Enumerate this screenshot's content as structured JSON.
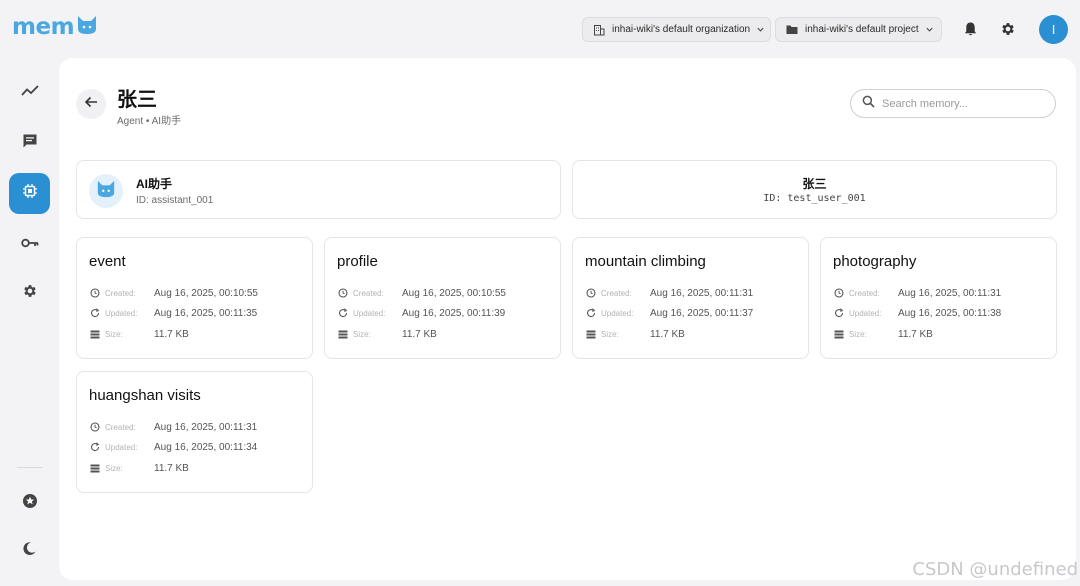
{
  "app": {
    "logo_text": "mem"
  },
  "header": {
    "organization": "inhai-wiki's default organization",
    "project": "inhai-wiki's default project",
    "avatar_initial": "I"
  },
  "sidebar": {
    "items": [
      {
        "name": "activity",
        "icon": "trend-chart-icon",
        "active": false
      },
      {
        "name": "chat",
        "icon": "message-icon",
        "active": false
      },
      {
        "name": "agents",
        "icon": "chip-icon",
        "active": true
      },
      {
        "name": "api-keys",
        "icon": "key-icon",
        "active": false
      },
      {
        "name": "settings",
        "icon": "gear-icon",
        "active": false
      }
    ],
    "bottom": [
      {
        "name": "favorites",
        "icon": "star-icon"
      },
      {
        "name": "theme",
        "icon": "moon-icon"
      }
    ]
  },
  "page": {
    "title": "张三",
    "subtitle": "Agent • AI助手"
  },
  "search": {
    "placeholder": "Search memory..."
  },
  "agent": {
    "name": "AI助手",
    "id_text": "ID: assistant_001"
  },
  "user": {
    "name": "张三",
    "id_text": "ID: test_user_001"
  },
  "labels": {
    "created": "Created:",
    "updated": "Updated:",
    "size": "Size:"
  },
  "memories": [
    {
      "title": "event",
      "created": "Aug 16, 2025, 00:10:55",
      "updated": "Aug 16, 2025, 00:11:35",
      "size": "11.7 KB"
    },
    {
      "title": "profile",
      "created": "Aug 16, 2025, 00:10:55",
      "updated": "Aug 16, 2025, 00:11:39",
      "size": "11.7 KB"
    },
    {
      "title": "mountain climbing",
      "created": "Aug 16, 2025, 00:11:31",
      "updated": "Aug 16, 2025, 00:11:37",
      "size": "11.7 KB"
    },
    {
      "title": "photography",
      "created": "Aug 16, 2025, 00:11:31",
      "updated": "Aug 16, 2025, 00:11:38",
      "size": "11.7 KB"
    },
    {
      "title": "huangshan visits",
      "created": "Aug 16, 2025, 00:11:31",
      "updated": "Aug 16, 2025, 00:11:34",
      "size": "11.7 KB"
    }
  ],
  "watermark": "CSDN @undefined",
  "colors": {
    "accent": "#2a8fd3",
    "logo": "#4aa7df",
    "background": "#f3f3f5"
  }
}
